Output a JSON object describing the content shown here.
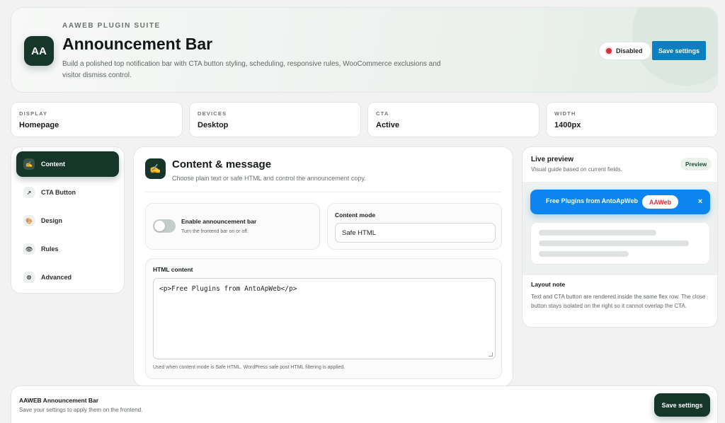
{
  "header": {
    "logo": "AA",
    "eyebrow": "AAWEB PLUGIN SUITE",
    "title": "Announcement Bar",
    "description": "Build a polished top notification bar with CTA button styling, scheduling, responsive rules, WooCommerce exclusions and visitor dismiss control.",
    "status": "Disabled",
    "status_color": "#d4313b",
    "save_label": "Save settings"
  },
  "stats": [
    {
      "label": "DISPLAY",
      "value": "Homepage"
    },
    {
      "label": "DEVICES",
      "value": "Desktop"
    },
    {
      "label": "CTA",
      "value": "Active"
    },
    {
      "label": "WIDTH",
      "value": "1400px"
    }
  ],
  "sidebar": {
    "items": [
      {
        "label": "Content",
        "icon": "✍",
        "icon_name": "writing-hand-icon",
        "active": true
      },
      {
        "label": "CTA Button",
        "icon": "↗",
        "icon_name": "arrow-icon",
        "active": false
      },
      {
        "label": "Design",
        "icon": "🎨",
        "icon_name": "palette-icon",
        "active": false
      },
      {
        "label": "Rules",
        "icon": "👁",
        "icon_name": "eye-icon",
        "active": false
      },
      {
        "label": "Advanced",
        "icon": "⚙",
        "icon_name": "gear-icon",
        "active": false
      }
    ]
  },
  "main": {
    "icon": "✍",
    "title": "Content & message",
    "subtitle": "Choose plain text or safe HTML and control the announcement copy.",
    "enable": {
      "title": "Enable announcement bar",
      "help": "Turn the frontend bar on or off.",
      "enabled": false
    },
    "mode": {
      "label": "Content mode",
      "value": "Safe HTML"
    },
    "html": {
      "label": "HTML content",
      "value": "<p>Free Plugins from AntoApWeb</p>",
      "help": "Used when content mode is Safe HTML. WordPress safe post HTML filtering is applied."
    }
  },
  "preview": {
    "title": "Live preview",
    "subtitle": "Visual guide based on current fields.",
    "badge": "Preview",
    "bar_text": "Free Plugins from AntoApWeb",
    "cta_label": "AAWeb",
    "close_glyph": "×",
    "bar_color": "#0d85ee",
    "cta_text_color": "#d8363f",
    "note_title": "Layout note",
    "note_text": "Text and CTA button are rendered inside the same flex row. The close button stays isolated on the right so it cannot overlap the CTA."
  },
  "footer": {
    "title": "AAWEB Announcement Bar",
    "subtitle": "Save your settings to apply them on the frontend.",
    "save_label": "Save settings"
  }
}
